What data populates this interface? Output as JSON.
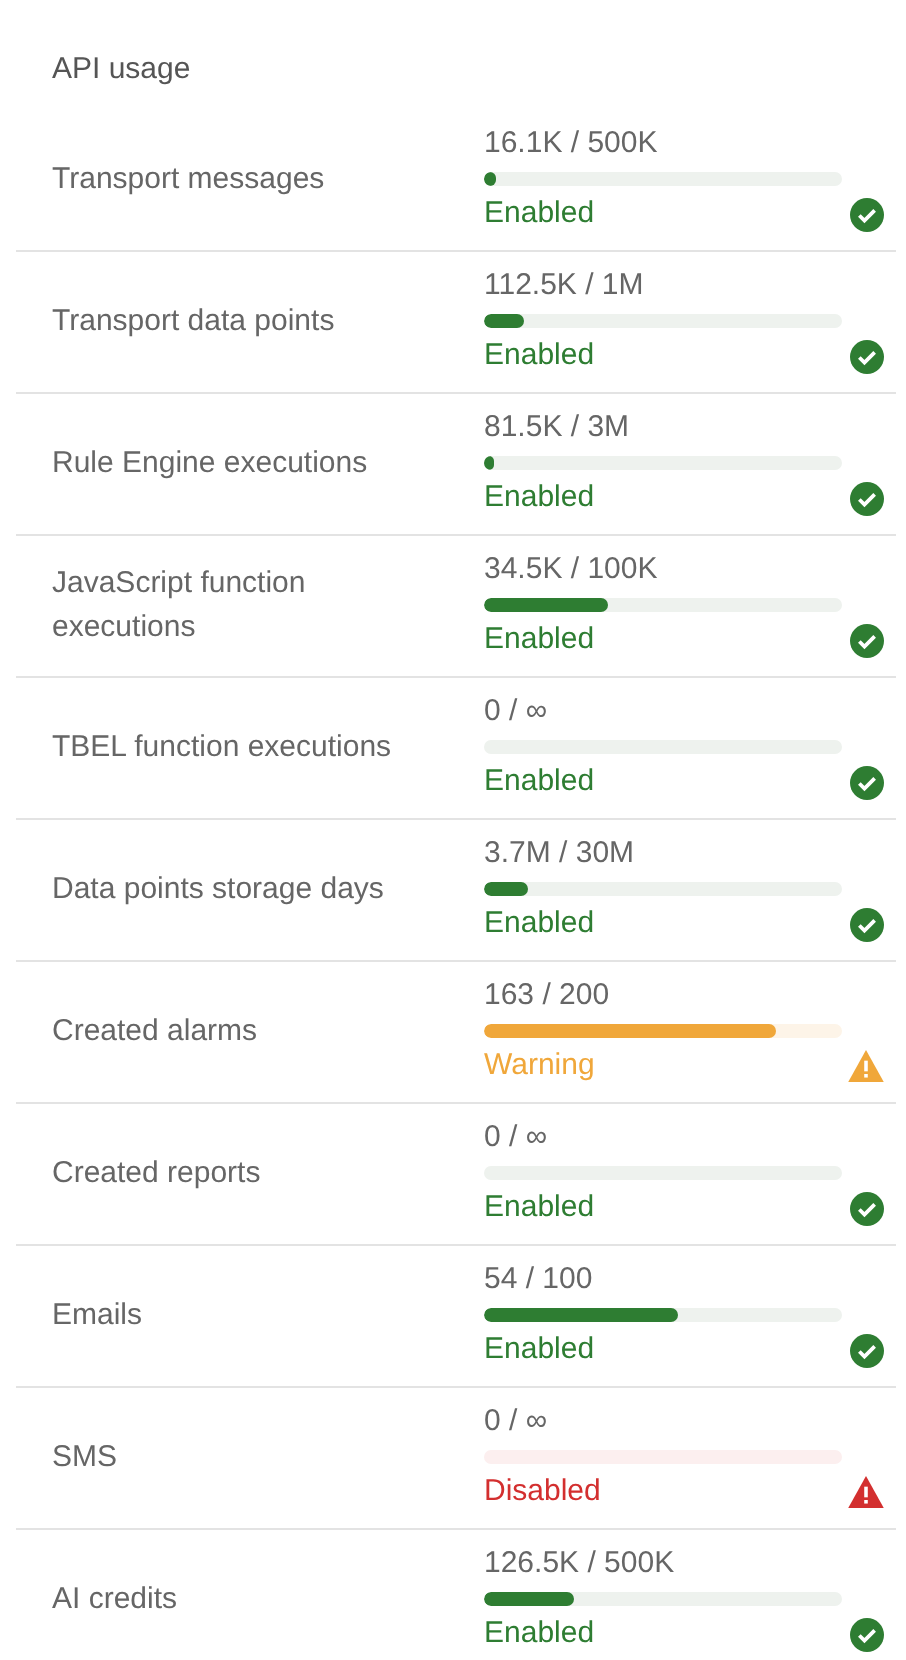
{
  "title": "API usage",
  "items": [
    {
      "label": "Transport messages",
      "reading": "16.1K / 500K",
      "level": 0.032,
      "status": "Enabled",
      "kind": "enabled"
    },
    {
      "label": "Transport data points",
      "reading": "112.5K / 1M",
      "level": 0.1125,
      "status": "Enabled",
      "kind": "enabled"
    },
    {
      "label": "Rule Engine executions",
      "reading": "81.5K / 3M",
      "level": 0.027,
      "status": "Enabled",
      "kind": "enabled"
    },
    {
      "label": "JavaScript function executions",
      "reading": "34.5K / 100K",
      "level": 0.345,
      "status": "Enabled",
      "kind": "enabled"
    },
    {
      "label": "TBEL function executions",
      "reading": "0 / ∞",
      "status": "Enabled",
      "kind": "enabled"
    },
    {
      "label": "Data points storage days",
      "reading": "3.7M / 30M",
      "level": 0.123,
      "status": "Enabled",
      "kind": "enabled"
    },
    {
      "label": "Created alarms",
      "reading": "163 / 200",
      "level": 0.815,
      "status": "Warning",
      "kind": "warning"
    },
    {
      "label": "Created reports",
      "reading": "0 / ∞",
      "status": "Enabled",
      "kind": "enabled"
    },
    {
      "label": "Emails",
      "reading": "54 / 100",
      "level": 0.54,
      "status": "Enabled",
      "kind": "enabled"
    },
    {
      "label": "SMS",
      "reading": "0 / ∞",
      "status": "Disabled",
      "kind": "disabled"
    },
    {
      "label": "AI credits",
      "reading": "126.5K / 500K",
      "level": 0.253,
      "status": "Enabled",
      "kind": "enabled"
    }
  ]
}
